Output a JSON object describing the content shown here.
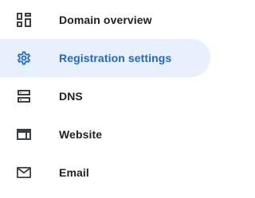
{
  "sidebar": {
    "colors": {
      "text": "#202124",
      "icon": "#3c4043",
      "active_text": "#1967d2",
      "active_background": "#e8f0fe"
    },
    "items": [
      {
        "label": "Domain overview",
        "icon": "dashboard-icon",
        "active": false
      },
      {
        "label": "Registration settings",
        "icon": "gear-icon",
        "active": true
      },
      {
        "label": "DNS",
        "icon": "dns-icon",
        "active": false
      },
      {
        "label": "Website",
        "icon": "web-icon",
        "active": false
      },
      {
        "label": "Email",
        "icon": "mail-icon",
        "active": false
      }
    ]
  }
}
